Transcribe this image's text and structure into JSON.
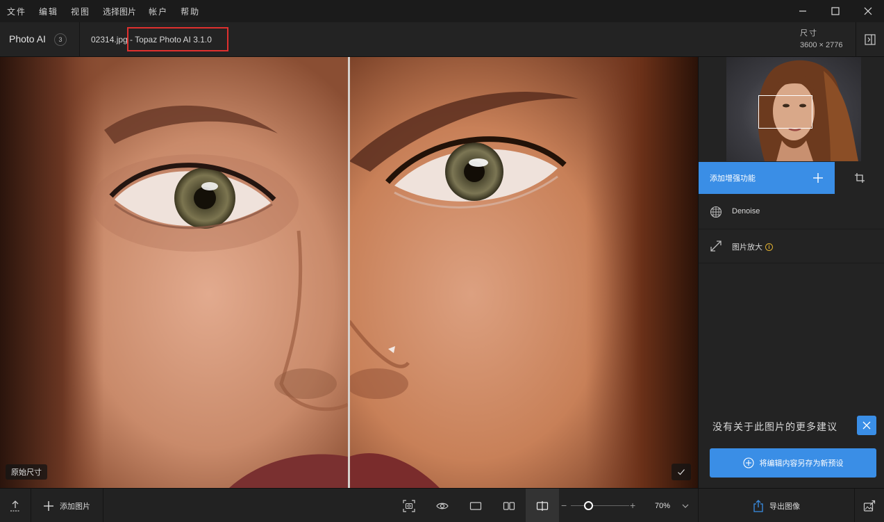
{
  "menu": [
    "文件",
    "编辑",
    "视图",
    "选择图片",
    "帐户",
    "帮助"
  ],
  "header": {
    "app_name": "Photo AI",
    "image_count": "3",
    "file_name": "02314.jpg",
    "app_version": " - Topaz Photo AI 3.1.0",
    "dimensions_label": "尺寸",
    "dimensions_value": "3600 × 2776"
  },
  "viewer": {
    "original_size_label": "原始尺寸"
  },
  "side_panel": {
    "add_enhancement_label": "添加增强功能",
    "features": [
      {
        "label": "Denoise",
        "icon": "denoise-icon"
      },
      {
        "label": "图片放大",
        "icon": "upscale-icon",
        "info": true
      }
    ],
    "no_more_suggestions": "没有关于此图片的更多建议",
    "save_preset_label": "将编辑内容另存为新预设"
  },
  "bottom_bar": {
    "add_image_label": "添加图片",
    "zoom_value": "70%",
    "zoom_level": 0.3,
    "export_label": "导出图像"
  },
  "colors": {
    "accent": "#3a8ee6",
    "highlight_box": "#e0302e",
    "info": "#e0b030"
  }
}
